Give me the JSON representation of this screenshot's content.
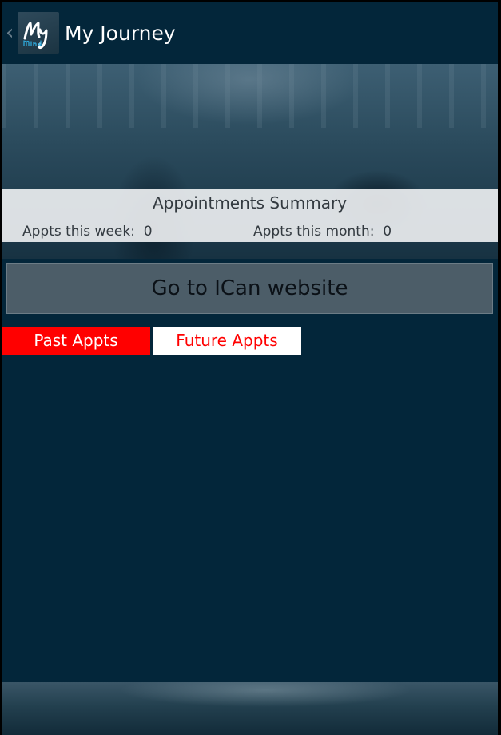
{
  "app": {
    "title": "My Journey",
    "logo_text_main": "My",
    "logo_text_sub": "mind"
  },
  "summary": {
    "heading": "Appointments Summary",
    "week_label": "Appts this week:",
    "week_value": "0",
    "month_label": "Appts this month:",
    "month_value": "0"
  },
  "actions": {
    "website_button": "Go to ICan website"
  },
  "tabs": {
    "past": "Past Appts",
    "future": "Future Appts"
  },
  "colors": {
    "background": "#03263a",
    "tab_active": "#ff0000",
    "tab_inactive": "#ffffff"
  }
}
